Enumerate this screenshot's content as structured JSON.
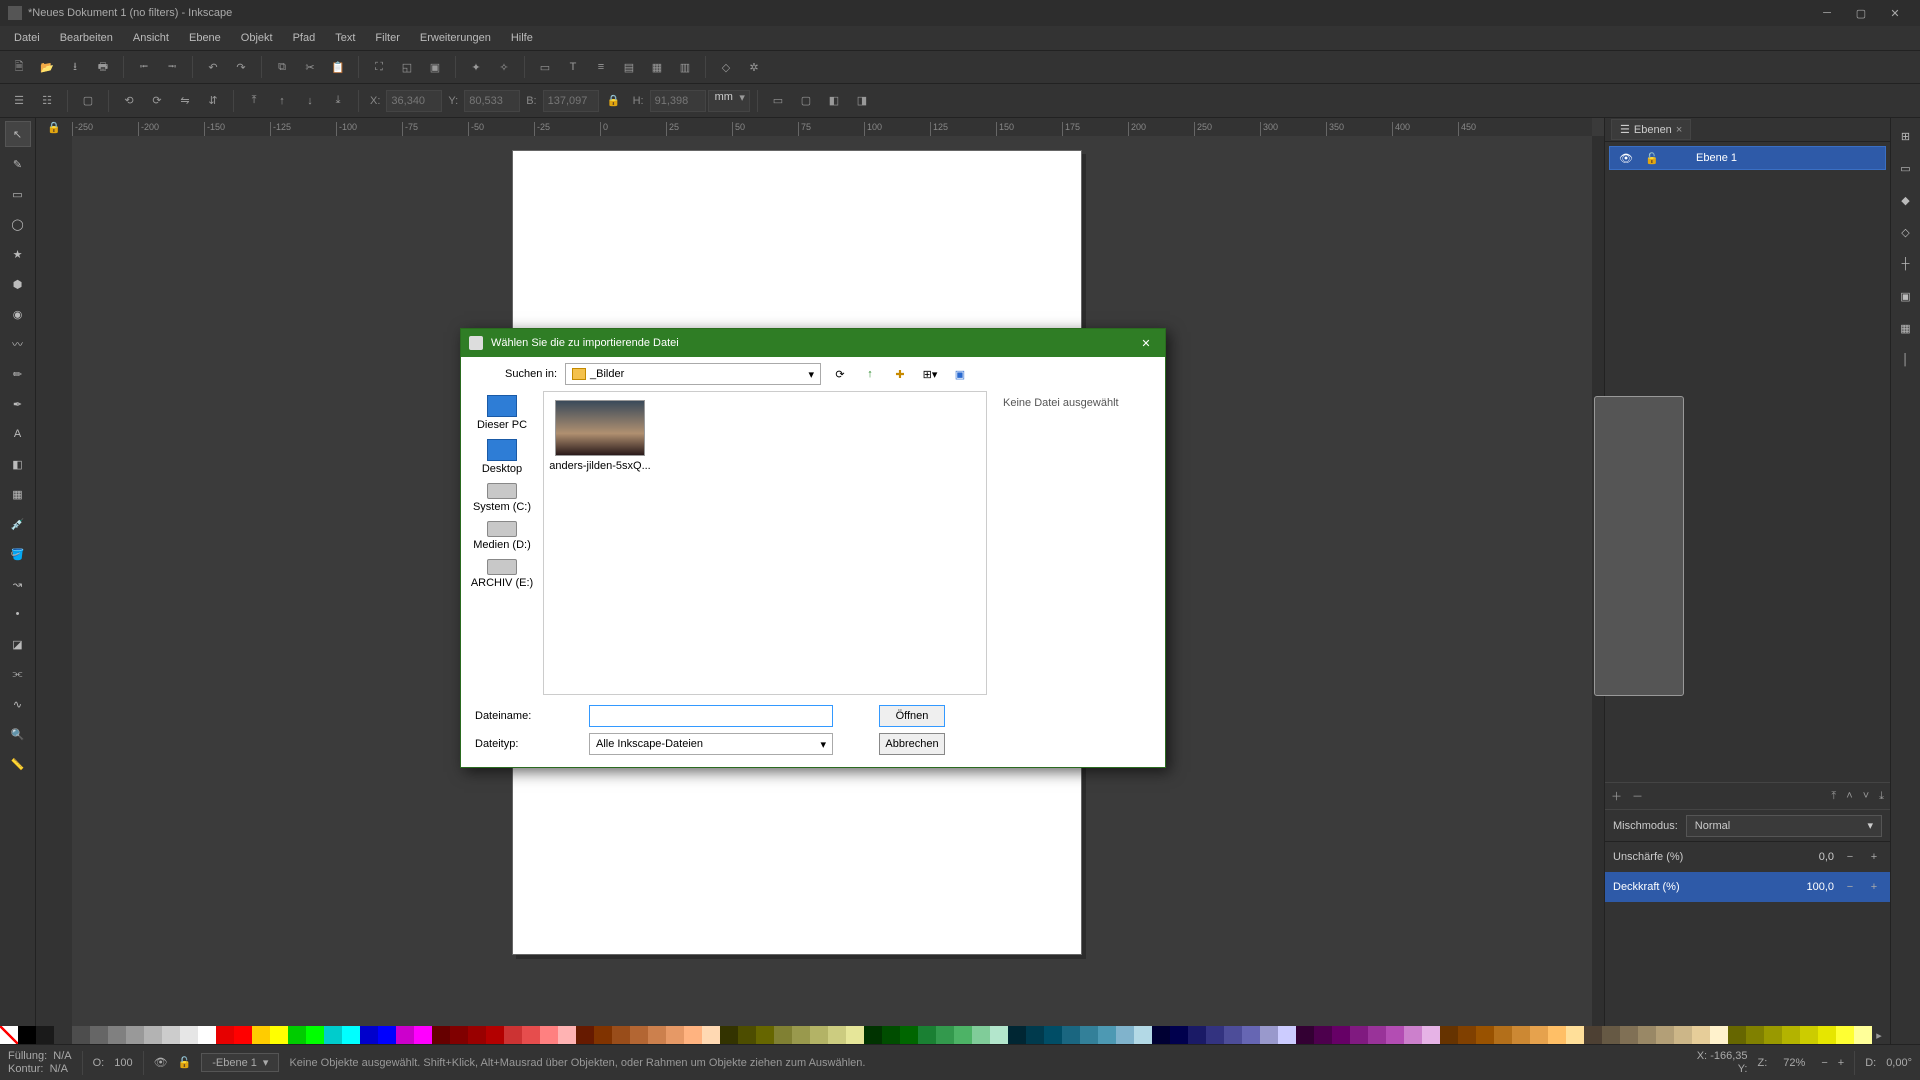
{
  "window": {
    "title": "*Neues Dokument 1 (no filters) - Inkscape"
  },
  "menu": {
    "items": [
      "Datei",
      "Bearbeiten",
      "Ansicht",
      "Ebene",
      "Objekt",
      "Pfad",
      "Text",
      "Filter",
      "Erweiterungen",
      "Hilfe"
    ]
  },
  "options_bar": {
    "x_label": "X:",
    "x_value": "36,340",
    "y_label": "Y:",
    "y_value": "80,533",
    "w_label": "B:",
    "w_value": "137,097",
    "h_label": "H:",
    "h_value": "91,398",
    "unit": "mm"
  },
  "ruler_ticks": [
    "-250",
    "-200",
    "-150",
    "-125",
    "-100",
    "-75",
    "-50",
    "-25",
    "0",
    "25",
    "50",
    "75",
    "100",
    "125",
    "150",
    "175",
    "200",
    "250",
    "300",
    "350",
    "400",
    "450"
  ],
  "dock": {
    "tab_label": "Ebenen",
    "layer_name": "Ebene 1",
    "blend_label": "Mischmodus:",
    "blend_value": "Normal",
    "blur_label": "Unschärfe (%)",
    "blur_value": "0,0",
    "opacity_label": "Deckkraft (%)",
    "opacity_value": "100,0"
  },
  "statusbar": {
    "fill_label": "Füllung:",
    "fill_value": "N/A",
    "stroke_label": "Kontur:",
    "stroke_value": "N/A",
    "o_label": "O:",
    "o_value": "100",
    "layer_chip": "-Ebene 1",
    "message": "Keine Objekte ausgewählt. Shift+Klick, Alt+Mausrad über Objekten, oder Rahmen um Objekte ziehen zum Auswählen.",
    "coord_x_label": "X:",
    "coord_x_value": "-166,35",
    "coord_y_label": "Y:",
    "coord_y_value": "",
    "zoom_label": "Z:",
    "zoom_value": "72%",
    "rot_label": "D:",
    "rot_value": "0,00°"
  },
  "dialog": {
    "title": "Wählen Sie die zu importierende Datei",
    "search_label": "Suchen in:",
    "folder": "_Bilder",
    "no_file": "Keine Datei ausgewählt",
    "places": [
      "Dieser PC",
      "Desktop",
      "System (C:)",
      "Medien (D:)",
      "ARCHIV (E:)"
    ],
    "file_item": "anders-jilden-5sxQ...",
    "filename_label": "Dateiname:",
    "filename_value": "",
    "filetype_label": "Dateityp:",
    "filetype_value": "Alle Inkscape-Dateien",
    "open_btn": "Öffnen",
    "cancel_btn": "Abbrechen"
  },
  "palette_colors": [
    "#000000",
    "#1a1a1a",
    "#333333",
    "#4d4d4d",
    "#666666",
    "#808080",
    "#999999",
    "#b3b3b3",
    "#cccccc",
    "#e6e6e6",
    "#ffffff",
    "#e60000",
    "#ff0000",
    "#ffcc00",
    "#ffff00",
    "#00cc00",
    "#00ff00",
    "#00cccc",
    "#00ffff",
    "#0000cc",
    "#0000ff",
    "#cc00cc",
    "#ff00ff",
    "#660000",
    "#800000",
    "#990000",
    "#b30000",
    "#cc3333",
    "#e64d4d",
    "#ff8080",
    "#ffb3b3",
    "#661a00",
    "#803300",
    "#994d1a",
    "#b36633",
    "#cc804d",
    "#e69966",
    "#ffb380",
    "#ffd9b3",
    "#333300",
    "#4d4d00",
    "#666600",
    "#808033",
    "#99994d",
    "#b3b366",
    "#cccc80",
    "#e6e699",
    "#003300",
    "#004d00",
    "#006600",
    "#1a8033",
    "#33994d",
    "#4db366",
    "#80cc99",
    "#b3e6cc",
    "#002633",
    "#003a4d",
    "#004d66",
    "#1a6680",
    "#338099",
    "#4d99b3",
    "#80b3cc",
    "#b3d9e6",
    "#000033",
    "#00004d",
    "#1a1a66",
    "#333380",
    "#4d4d99",
    "#6666b3",
    "#9999cc",
    "#ccccff",
    "#330033",
    "#4d004d",
    "#660066",
    "#801a80",
    "#993399",
    "#b34db3",
    "#cc80cc",
    "#e6b3e6",
    "#663300",
    "#804000",
    "#995200",
    "#b36f1a",
    "#cc8833",
    "#e6a24d",
    "#ffbf66",
    "#ffdf99",
    "#4d4033",
    "#665944",
    "#807055",
    "#998866",
    "#b39f77",
    "#ccb688",
    "#e6cd99",
    "#fff2cc",
    "#666600",
    "#808000",
    "#999900",
    "#b3b300",
    "#cccc00",
    "#e6e600",
    "#ffff33",
    "#ffff99"
  ]
}
